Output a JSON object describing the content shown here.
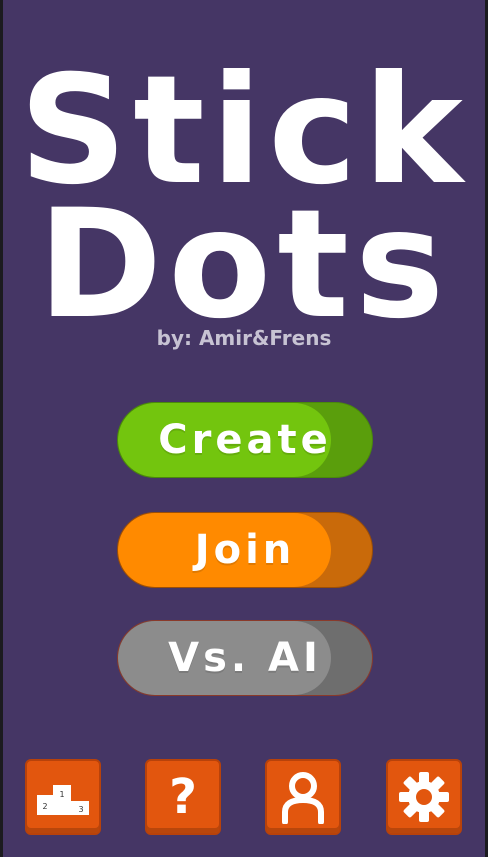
{
  "title": {
    "line1": "Stick",
    "line2": "Dots"
  },
  "byline": "by: Amir&Frens",
  "buttons": {
    "create": "Create",
    "join": "Join",
    "vs_ai": "Vs. AI"
  },
  "podium": {
    "first": "1",
    "second": "2",
    "third": "3"
  },
  "help": {
    "glyph": "?"
  },
  "colors": {
    "background": "#453665",
    "create": "#73c50e",
    "join": "#ff8a00",
    "vs_ai": "#8c8c8c",
    "tile": "#e2560e"
  },
  "icons": [
    "leaderboard-podium-icon",
    "help-question-icon",
    "profile-person-icon",
    "settings-gear-icon"
  ]
}
